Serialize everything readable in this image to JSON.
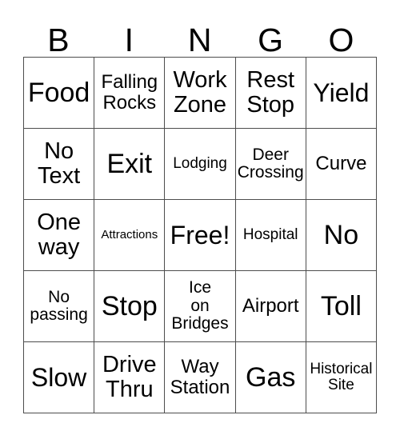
{
  "card": {
    "headers": [
      "B",
      "I",
      "N",
      "G",
      "O"
    ],
    "rows": [
      [
        {
          "text": "Food",
          "size": "fs-xxl"
        },
        {
          "text": "Falling\nRocks",
          "size": "fs-md"
        },
        {
          "text": "Work\nZone",
          "size": "fs-lg"
        },
        {
          "text": "Rest\nStop",
          "size": "fs-lg"
        },
        {
          "text": "Yield",
          "size": "fs-xl"
        }
      ],
      [
        {
          "text": "No\nText",
          "size": "fs-lg"
        },
        {
          "text": "Exit",
          "size": "fs-xxl"
        },
        {
          "text": "Lodging",
          "size": "fs-xs"
        },
        {
          "text": "Deer\nCrossing",
          "size": "fs-sm"
        },
        {
          "text": "Curve",
          "size": "fs-md"
        }
      ],
      [
        {
          "text": "One\nway",
          "size": "fs-lg"
        },
        {
          "text": "Attractions",
          "size": "fs-xxs"
        },
        {
          "text": "Free!",
          "size": "fs-xl"
        },
        {
          "text": "Hospital",
          "size": "fs-xs"
        },
        {
          "text": "No",
          "size": "fs-xxl"
        }
      ],
      [
        {
          "text": "No\npassing",
          "size": "fs-sm"
        },
        {
          "text": "Stop",
          "size": "fs-xxl"
        },
        {
          "text": "Ice\non\nBridges",
          "size": "fs-sm"
        },
        {
          "text": "Airport",
          "size": "fs-md"
        },
        {
          "text": "Toll",
          "size": "fs-xxl"
        }
      ],
      [
        {
          "text": "Slow",
          "size": "fs-xl"
        },
        {
          "text": "Drive\nThru",
          "size": "fs-lg"
        },
        {
          "text": "Way\nStation",
          "size": "fs-md"
        },
        {
          "text": "Gas",
          "size": "fs-xxl"
        },
        {
          "text": "Historical\nSite",
          "size": "fs-xs"
        }
      ]
    ]
  }
}
